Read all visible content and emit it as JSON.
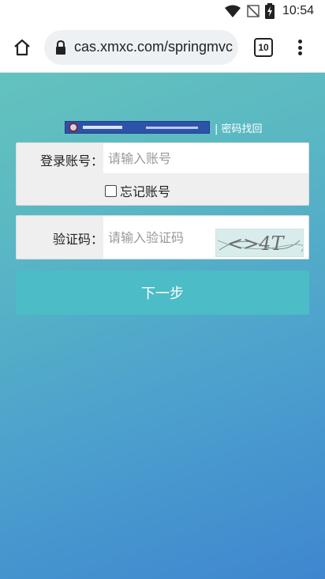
{
  "status_bar": {
    "time": "10:54"
  },
  "browser": {
    "url": "cas.xmxc.com/springmvc",
    "tab_count": "10"
  },
  "page": {
    "banner": {
      "password_recovery_link": "| 密码找回"
    },
    "login_form": {
      "account_label": "登录账号：",
      "account_placeholder": "请输入账号",
      "remember_label": "忘记账号"
    },
    "captcha_form": {
      "captcha_label": "验证码：",
      "captcha_placeholder": "请输入验证码",
      "captcha_text": "<>4T"
    },
    "next_button": "下一步"
  },
  "colors": {
    "gradient_top": "#63c3bd",
    "gradient_bottom": "#3f86cf",
    "button": "#4cbcc6",
    "logo_bar": "#2d53a8"
  }
}
